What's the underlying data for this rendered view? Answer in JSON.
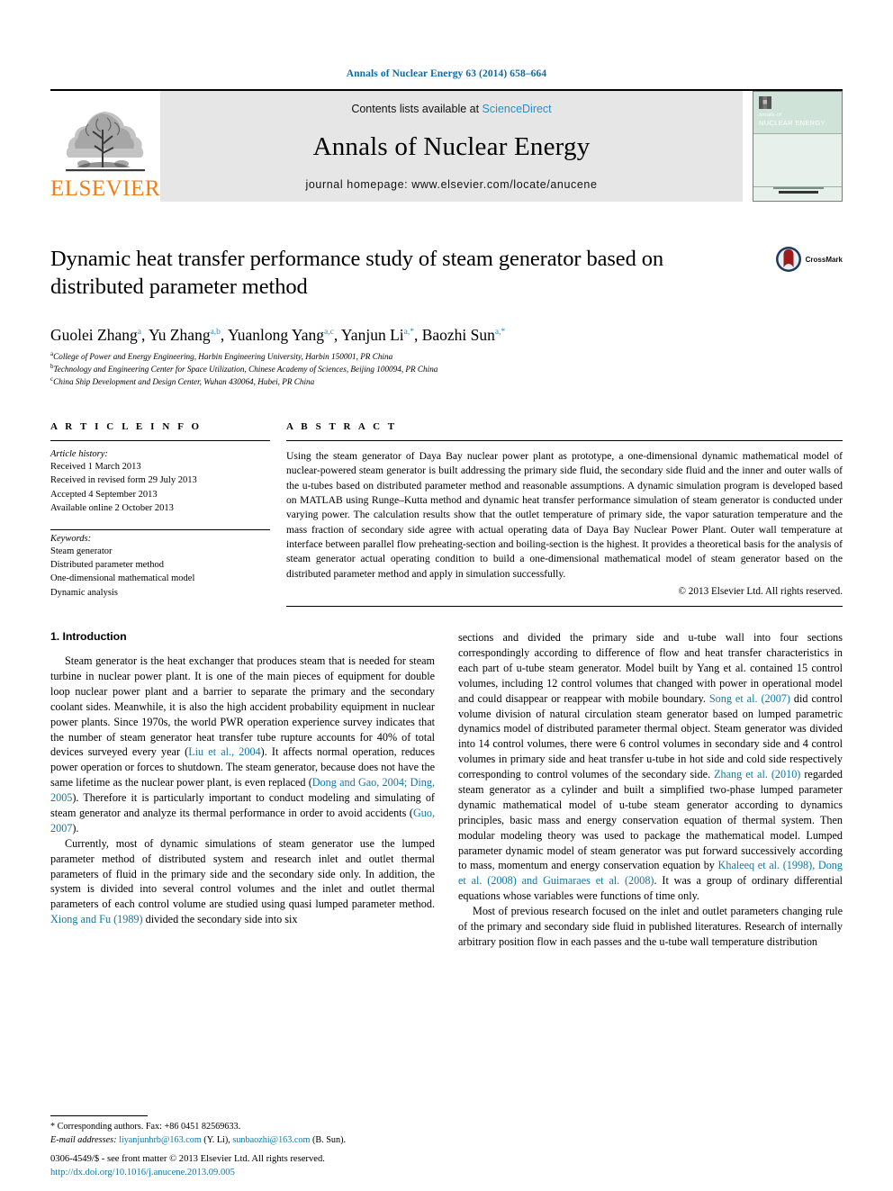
{
  "running_head": "Annals of Nuclear Energy 63 (2014) 658–664",
  "masthead": {
    "publisher": "ELSEVIER",
    "contents_prefix": "Contents lists available at ",
    "contents_link": "ScienceDirect",
    "journal_name": "Annals of Nuclear Energy",
    "homepage": "journal homepage: www.elsevier.com/locate/anucene",
    "cover_title_small": "annals of",
    "cover_title_big": "NUCLEAR ENERGY"
  },
  "title": "Dynamic heat transfer performance study of steam generator based on distributed parameter method",
  "crossmark_label": "CrossMark",
  "authors": [
    {
      "name": "Guolei Zhang",
      "sup": "a"
    },
    {
      "name": "Yu Zhang",
      "sup": "a,b"
    },
    {
      "name": "Yuanlong Yang",
      "sup": "a,c"
    },
    {
      "name": "Yanjun Li",
      "sup": "a,*"
    },
    {
      "name": "Baozhi Sun",
      "sup": "a,*"
    }
  ],
  "affiliations": [
    {
      "marker": "a",
      "text": "College of Power and Energy Engineering, Harbin Engineering University, Harbin 150001, PR China"
    },
    {
      "marker": "b",
      "text": "Technology and Engineering Center for Space Utilization, Chinese Academy of Sciences, Beijing 100094, PR China"
    },
    {
      "marker": "c",
      "text": "China Ship Development and Design Center, Wuhan 430064, Hubei, PR China"
    }
  ],
  "article_info": {
    "heading": "A R T I C L E    I N F O",
    "history_label": "Article history:",
    "history": [
      "Received 1 March 2013",
      "Received in revised form 29 July 2013",
      "Accepted 4 September 2013",
      "Available online 2 October 2013"
    ],
    "keywords_label": "Keywords:",
    "keywords": [
      "Steam generator",
      "Distributed parameter method",
      "One-dimensional mathematical model",
      "Dynamic analysis"
    ]
  },
  "abstract": {
    "heading": "A B S T R A C T",
    "text": "Using the steam generator of Daya Bay nuclear power plant as prototype, a one-dimensional dynamic mathematical model of nuclear-powered steam generator is built addressing the primary side fluid, the secondary side fluid and the inner and outer walls of the u-tubes based on distributed parameter method and reasonable assumptions. A dynamic simulation program is developed based on MATLAB using Runge–Kutta method and dynamic heat transfer performance simulation of steam generator is conducted under varying power. The calculation results show that the outlet temperature of primary side, the vapor saturation temperature and the mass fraction of secondary side agree with actual operating data of Daya Bay Nuclear Power Plant. Outer wall temperature at interface between parallel flow preheating-section and boiling-section is the highest. It provides a theoretical basis for the analysis of steam generator actual operating condition to build a one-dimensional mathematical model of steam generator based on the distributed parameter method and apply in simulation successfully.",
    "copyright": "© 2013 Elsevier Ltd. All rights reserved."
  },
  "introduction": {
    "section_title": "1. Introduction",
    "left": [
      {
        "id": "p1",
        "parts": [
          {
            "t": "Steam generator is the heat exchanger that produces steam that is needed for steam turbine in nuclear power plant. It is one of the main pieces of equipment for double loop nuclear power plant and a barrier to separate the primary and the secondary coolant sides. Meanwhile, it is also the high accident probability equipment in nuclear power plants. Since 1970s, the world PWR operation experience survey indicates that the number of steam generator heat transfer tube rupture accounts for 40% of total devices surveyed every year ("
          },
          {
            "t": "Liu et al., 2004",
            "cite": true
          },
          {
            "t": "). It affects normal operation, reduces power operation or forces to shutdown. The steam generator, because does not have the same lifetime as the nuclear power plant, is even replaced ("
          },
          {
            "t": "Dong and Gao, 2004; Ding, 2005",
            "cite": true
          },
          {
            "t": "). Therefore it is particularly important to conduct modeling and simulating of steam generator and analyze its thermal performance in order to avoid accidents ("
          },
          {
            "t": "Guo, 2007",
            "cite": true
          },
          {
            "t": ")."
          }
        ]
      },
      {
        "id": "p2",
        "parts": [
          {
            "t": "Currently, most of dynamic simulations of steam generator use the lumped parameter method of distributed system and research inlet and outlet thermal parameters of fluid in the primary side and the secondary side only. In addition, the system is divided into several control volumes and the inlet and outlet thermal parameters of each control volume are studied using quasi lumped parameter method. "
          },
          {
            "t": "Xiong and Fu (1989)",
            "cite": true
          },
          {
            "t": " divided the secondary side into six"
          }
        ]
      }
    ],
    "right": [
      {
        "id": "p3",
        "parts": [
          {
            "t": "sections and divided the primary side and u-tube wall into four sections correspondingly according to difference of flow and heat transfer characteristics in each part of u-tube steam generator. Model built by Yang et al. contained 15 control volumes, including 12 control volumes that changed with power in operational model and could disappear or reappear with mobile boundary. "
          },
          {
            "t": "Song et al. (2007)",
            "cite": true
          },
          {
            "t": " did control volume division of natural circulation steam generator based on lumped parametric dynamics model of distributed parameter thermal object. Steam generator was divided into 14 control volumes, there were 6 control volumes in secondary side and 4 control volumes in primary side and heat transfer u-tube in hot side and cold side respectively corresponding to control volumes of the secondary side. "
          },
          {
            "t": "Zhang et al. (2010)",
            "cite": true
          },
          {
            "t": " regarded steam generator as a cylinder and built a simplified two-phase lumped parameter dynamic mathematical model of u-tube steam generator according to dynamics principles, basic mass and energy conservation equation of thermal system. Then modular modeling theory was used to package the mathematical model. Lumped parameter dynamic model of steam generator was put forward successively according to mass, momentum and energy conservation equation by "
          },
          {
            "t": "Khaleeq et al. (1998), Dong et al. (2008) and Guimaraes et al. (2008)",
            "cite": true
          },
          {
            "t": ". It was a group of ordinary differential equations whose variables were functions of time only."
          }
        ]
      },
      {
        "id": "p4",
        "parts": [
          {
            "t": "Most of previous research focused on the inlet and outlet parameters changing rule of the primary and secondary side fluid in published literatures. Research of internally arbitrary position flow in each passes and the u-tube wall temperature distribution"
          }
        ]
      }
    ]
  },
  "footnote": {
    "marker": "*",
    "corresponding": "Corresponding authors. Fax: +86 0451 82569633.",
    "email_label": "E-mail addresses:",
    "emails": [
      {
        "address": "liyanjunhrb@163.com",
        "owner": "(Y. Li)"
      },
      {
        "address": "sunbaozhi@163.com",
        "owner": "(B. Sun)"
      }
    ]
  },
  "footer": {
    "issn_line": "0306-4549/$ - see front matter © 2013 Elsevier Ltd. All rights reserved.",
    "doi": "http://dx.doi.org/10.1016/j.anucene.2013.09.005"
  }
}
